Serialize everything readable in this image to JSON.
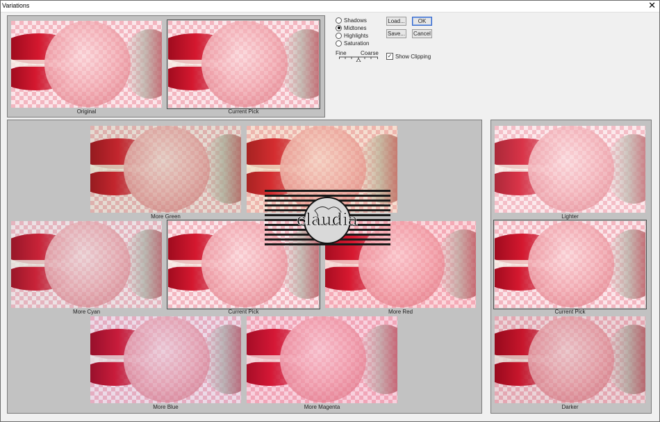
{
  "window": {
    "title": "Variations",
    "close_glyph": "✕"
  },
  "modes": [
    {
      "label": "Shadows",
      "selected": false
    },
    {
      "label": "Midtones",
      "selected": true
    },
    {
      "label": "Highlights",
      "selected": false
    },
    {
      "label": "Saturation",
      "selected": false
    }
  ],
  "buttons": {
    "load": "Load...",
    "ok": "OK",
    "save": "Save...",
    "cancel": "Cancel"
  },
  "slider": {
    "fine_label": "Fine",
    "coarse_label": "Coarse",
    "position": 0.5
  },
  "show_clipping": {
    "label": "Show Clipping",
    "checked": true,
    "check_glyph": "✓"
  },
  "top_previews": {
    "original": "Original",
    "current_pick": "Current Pick"
  },
  "hue_grid": {
    "more_green": "More Green",
    "more_yellow": "",
    "more_cyan": "More Cyan",
    "current_pick": "Current Pick",
    "more_red": "More Red",
    "more_blue": "More Blue",
    "more_magenta": "More Magenta"
  },
  "lightness": {
    "lighter": "Lighter",
    "current_pick": "Current Pick",
    "darker": "Darker"
  },
  "watermark": {
    "text": "claudia"
  },
  "colors": {
    "accent": "#2e62c9",
    "panel": "#c2c2c2",
    "checker_pink": "#f3b6c0",
    "lips_red": "#c2102a"
  }
}
